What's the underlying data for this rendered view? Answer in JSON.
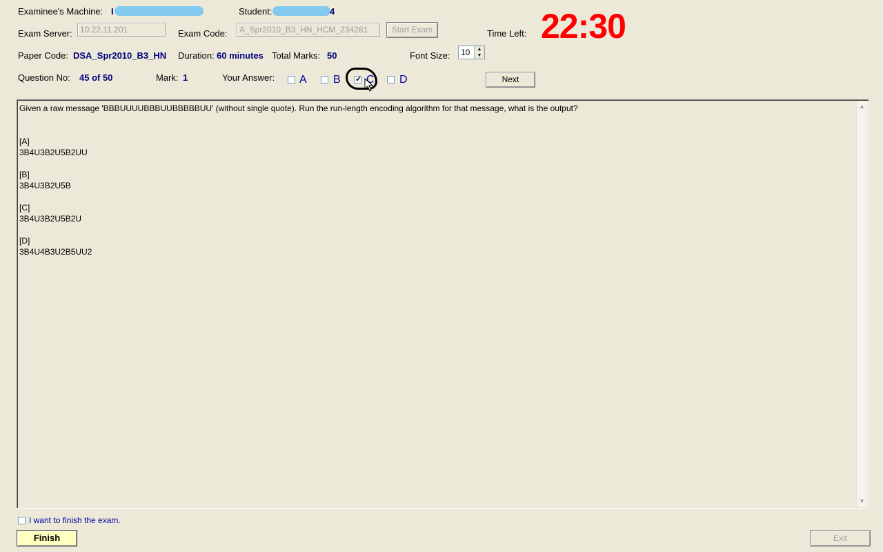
{
  "header": {
    "examinee_machine_label": "Examinee's Machine:",
    "examinee_machine_value": "I",
    "student_label": "Student:",
    "student_value_tail": "4",
    "exam_server_label": "Exam Server:",
    "exam_server_value": "10.22.11.201",
    "exam_code_label": "Exam Code:",
    "exam_code_value": "A_Spr2010_B3_HN_HCM_234281",
    "start_exam_label": "Start Exam",
    "time_left_label": "Time Left:",
    "time_left_value": "22:30",
    "paper_code_label": "Paper Code:",
    "paper_code_value": "DSA_Spr2010_B3_HN",
    "duration_label": "Duration:",
    "duration_value": "60 minutes",
    "total_marks_label": "Total Marks:",
    "total_marks_value": "50",
    "font_size_label": "Font Size:",
    "font_size_value": "10"
  },
  "question_bar": {
    "question_no_label": "Question No:",
    "question_no_value": "45 of 50",
    "mark_label": "Mark:",
    "mark_value": "1",
    "your_answer_label": "Your Answer:",
    "options": [
      {
        "label": "A",
        "checked": false
      },
      {
        "label": "B",
        "checked": false
      },
      {
        "label": "C",
        "checked": true
      },
      {
        "label": "D",
        "checked": false
      }
    ],
    "next_label": "Next"
  },
  "question": {
    "text": "Given a raw message 'BBBUUUUBBBUUBBBBBUU' (without single quote). Run the run-length encoding algorithm for that message, what is the output?",
    "answers": [
      {
        "tag": "[A]",
        "text": "3B4U3B2U5B2UU"
      },
      {
        "tag": "[B]",
        "text": "3B4U3B2U5B"
      },
      {
        "tag": "[C]",
        "text": "3B4U3B2U5B2U"
      },
      {
        "tag": "[D]",
        "text": "3B4U4B3U2B5UU2"
      }
    ]
  },
  "footer": {
    "finish_checkbox_label": "I want to finish the exam.",
    "finish_label": "Finish",
    "exit_label": "Exit"
  },
  "colors": {
    "background": "#ece9d8",
    "value_blue": "#00007f",
    "timer_red": "#ff0000",
    "finish_yellow": "#ffffc0"
  }
}
